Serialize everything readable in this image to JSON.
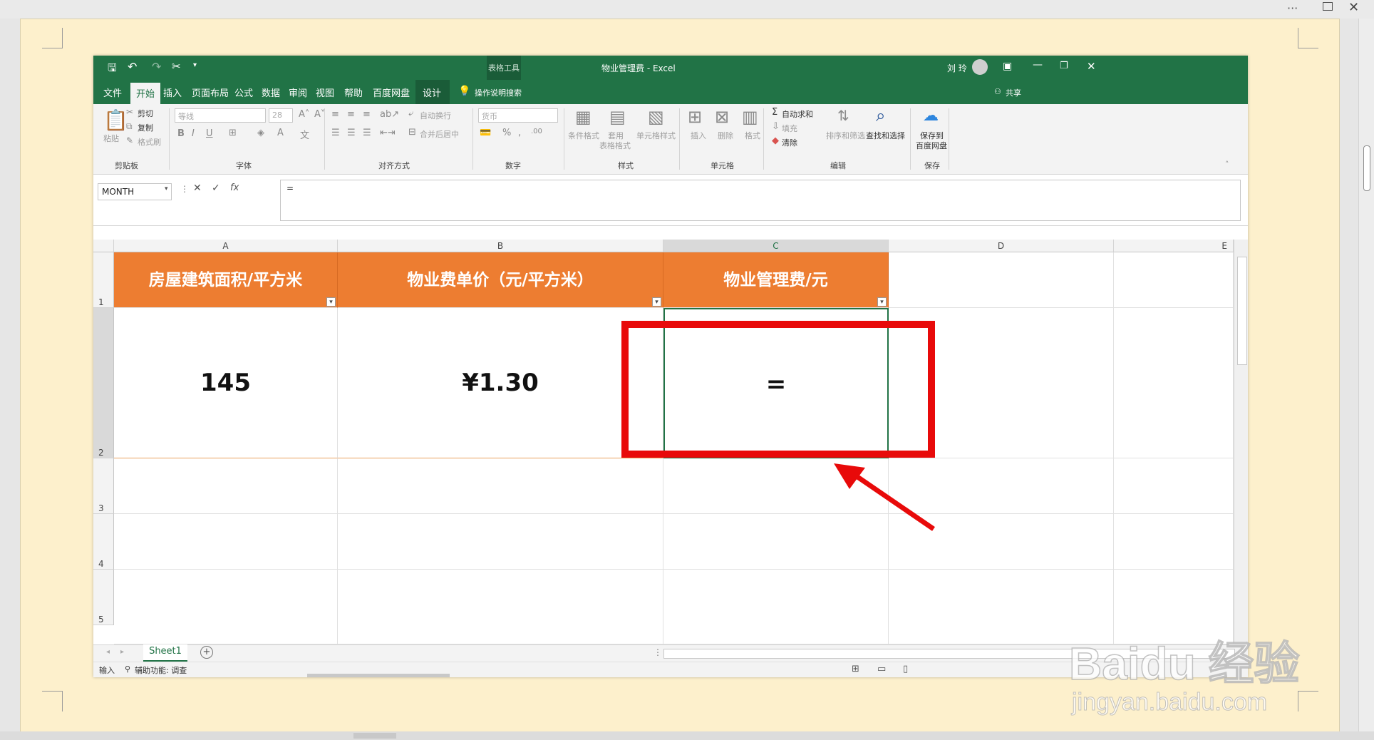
{
  "viewer": {
    "more_icon": "more-dots-icon",
    "close_symbol": "✕"
  },
  "excel": {
    "title": "物业管理费 - Excel",
    "context_tab_group": "表格工具",
    "user_name": "刘 玲",
    "tabs": [
      "文件",
      "开始",
      "插入",
      "页面布局",
      "公式",
      "数据",
      "审阅",
      "视图",
      "帮助",
      "百度网盘"
    ],
    "context_tab": "设计",
    "tell_me": "操作说明搜索",
    "share": "共享"
  },
  "ribbon": {
    "clipboard": {
      "paste": "粘贴",
      "cut": "剪切",
      "copy": "复制",
      "format_painter": "格式刷",
      "group": "剪贴板"
    },
    "font": {
      "font_name": "等线",
      "font_size": "28",
      "group": "字体"
    },
    "alignment": {
      "wrap": "自动换行",
      "merge": "合并后居中",
      "group": "对齐方式"
    },
    "number": {
      "format": "货币",
      "group": "数字"
    },
    "styles": {
      "conditional": "条件格式",
      "table_format": "套用\n表格格式",
      "cell_styles": "单元格样式",
      "group": "样式"
    },
    "cells": {
      "insert": "插入",
      "delete": "删除",
      "format": "格式",
      "group": "单元格"
    },
    "editing": {
      "autosum": "自动求和",
      "fill": "填充",
      "clear": "清除",
      "sort": "排序和筛选",
      "find": "查找和选择",
      "group": "编辑"
    },
    "save": {
      "label_1": "保存到",
      "label_2": "百度网盘",
      "group": "保存"
    }
  },
  "formula_bar": {
    "name_box": "MONTH",
    "formula": "="
  },
  "sheet": {
    "columns": [
      "A",
      "B",
      "C",
      "D",
      "E"
    ],
    "rows": [
      "1",
      "2",
      "3",
      "4",
      "5"
    ],
    "headers": [
      "房屋建筑面积/平方米",
      "物业费单价（元/平方米）",
      "物业管理费/元"
    ],
    "values": [
      "145",
      "¥1.30",
      "="
    ],
    "tab": "Sheet1"
  },
  "status": {
    "mode": "输入",
    "accessibility": "辅助功能: 调查"
  },
  "watermark": {
    "line1": "Baidu 经验",
    "line2": "jingyan.baidu.com"
  },
  "colors": {
    "excel_green": "#217346",
    "header_orange": "#ed7d31",
    "highlight_red": "#e80a0a",
    "page_bg": "#fdf0cc"
  }
}
